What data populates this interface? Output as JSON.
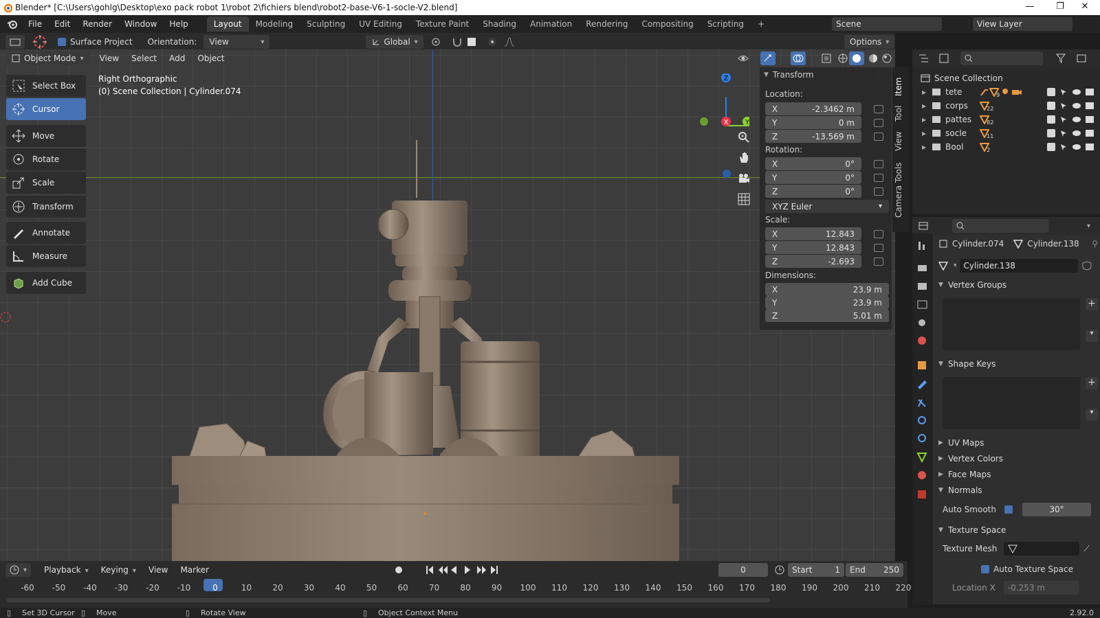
{
  "window": {
    "title": "Blender* [C:\\Users\\gohlg\\Desktop\\exo pack robot 1\\robot 2\\fichiers blend\\robot2-base-V6-1-socle-V2.blend]",
    "minimize": "—",
    "maximize": "❐",
    "close": "✕"
  },
  "menu": [
    "File",
    "Edit",
    "Render",
    "Window",
    "Help"
  ],
  "workspaces": [
    "Layout",
    "Modeling",
    "Sculpting",
    "UV Editing",
    "Texture Paint",
    "Shading",
    "Animation",
    "Rendering",
    "Compositing",
    "Scripting"
  ],
  "workspace_add": "+",
  "scene": {
    "name": "Scene",
    "view_layer": "View Layer"
  },
  "tool_header": {
    "surface_project": "Surface Project",
    "orientation_label": "Orientation:",
    "orientation_value": "View",
    "transform_orientation": "Global",
    "options": "Options"
  },
  "viewport_header": {
    "mode": "Object Mode",
    "menus": [
      "View",
      "Select",
      "Add",
      "Object"
    ]
  },
  "viewport": {
    "view_name": "Right Orthographic",
    "collection_info": "(0) Scene Collection | Cylinder.074"
  },
  "toolbar": [
    "Select Box",
    "Cursor",
    "Move",
    "Rotate",
    "Scale",
    "Transform",
    "Annotate",
    "Measure",
    "Add Cube"
  ],
  "side_tabs": [
    "Item",
    "Tool",
    "View",
    "Camera Tools"
  ],
  "gizmo": {
    "x": "X",
    "y": "Y",
    "z": "Z"
  },
  "transform": {
    "header": "Transform",
    "location_label": "Location:",
    "location": [
      {
        "axis": "X",
        "value": "-2.3462 m"
      },
      {
        "axis": "Y",
        "value": "0 m"
      },
      {
        "axis": "Z",
        "value": "-13.569 m"
      }
    ],
    "rotation_label": "Rotation:",
    "rotation": [
      {
        "axis": "X",
        "value": "0°"
      },
      {
        "axis": "Y",
        "value": "0°"
      },
      {
        "axis": "Z",
        "value": "0°"
      }
    ],
    "rotation_mode": "XYZ Euler",
    "scale_label": "Scale:",
    "scale": [
      {
        "axis": "X",
        "value": "12.843"
      },
      {
        "axis": "Y",
        "value": "12.843"
      },
      {
        "axis": "Z",
        "value": "-2.693"
      }
    ],
    "dimensions_label": "Dimensions:",
    "dimensions": [
      {
        "axis": "X",
        "value": "23.9 m"
      },
      {
        "axis": "Y",
        "value": "23.9 m"
      },
      {
        "axis": "Z",
        "value": "5.01 m"
      }
    ]
  },
  "outliner": {
    "root": "Scene Collection",
    "collections": [
      {
        "name": "tete",
        "count": "9"
      },
      {
        "name": "corps",
        "count": "22"
      },
      {
        "name": "pattes",
        "count": "82"
      },
      {
        "name": "socle",
        "count": "11"
      },
      {
        "name": "Bool",
        "count": "2"
      }
    ]
  },
  "properties": {
    "object_name": "Cylinder.074",
    "mesh_name": "Cylinder.138",
    "mesh_datablock": "Cylinder.138",
    "sections": {
      "vertex_groups": "Vertex Groups",
      "shape_keys": "Shape Keys",
      "uv_maps": "UV Maps",
      "vertex_colors": "Vertex Colors",
      "face_maps": "Face Maps",
      "normals": "Normals",
      "texture_space": "Texture Space"
    },
    "auto_smooth_label": "Auto Smooth",
    "auto_smooth_angle": "30°",
    "texture_mesh_label": "Texture Mesh",
    "auto_texture_space": "Auto Texture Space",
    "location_x_label": "Location X",
    "location_x_value": "-0.253 m"
  },
  "timeline": {
    "menus": [
      "Playback",
      "Keying",
      "View",
      "Marker"
    ],
    "current_frame": "0",
    "start_label": "Start",
    "start": "1",
    "end_label": "End",
    "end": "250",
    "ticks": [
      "-60",
      "-50",
      "-40",
      "-30",
      "-20",
      "-10",
      "0",
      "10",
      "20",
      "30",
      "40",
      "50",
      "60",
      "70",
      "80",
      "90",
      "100",
      "110",
      "120",
      "130",
      "140",
      "150",
      "160",
      "170",
      "180",
      "190",
      "200",
      "210",
      "220"
    ]
  },
  "status": {
    "set_cursor": "Set 3D Cursor",
    "move": "Move",
    "rotate_view": "Rotate View",
    "context_menu": "Object Context Menu",
    "version": "2.92.0"
  },
  "colors": {
    "accent": "#4772b3",
    "active_tool": "#4772b3",
    "x_axis": "#e8344a",
    "y_axis": "#8bd22c",
    "z_axis": "#2e7ee6",
    "model": "#8b7c6d"
  }
}
